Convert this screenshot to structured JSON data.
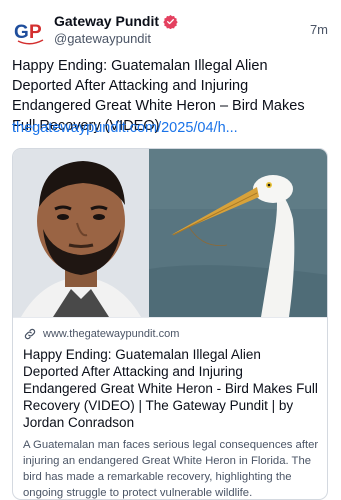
{
  "post": {
    "author": {
      "display_name": "Gateway Pundit",
      "handle": "@gatewaypundit",
      "avatar_text": "GP",
      "verified": true
    },
    "timestamp": "7m",
    "text": "Happy Ending: Guatemalan Illegal Alien Deported After Attacking and Injuring Endangered Great White Heron – Bird Makes Full Recovery (VIDEO)",
    "link_text": "thegatewaypundit.com/2025/04/h..."
  },
  "card": {
    "domain": "www.thegatewaypundit.com",
    "title": "Happy Ending: Guatemalan Illegal Alien Deported After Attacking and Injuring Endangered Great White Heron - Bird Makes Full Recovery (VIDEO) | The Gateway Pundit | by Jordan Conradson",
    "description": "A Guatemalan man faces serious legal consequences after injuring an endangered Great White Heron in Florida. The bird has made a remarkable recovery, highlighting the ongoing struggle to protect vulnerable wildlife."
  },
  "colors": {
    "link": "#1a73e8",
    "verified_badge": "#e4405f",
    "avatar_blue": "#1f4e9c",
    "avatar_red": "#d32f2f"
  },
  "icons": [
    "verified-badge-icon",
    "link-icon"
  ]
}
